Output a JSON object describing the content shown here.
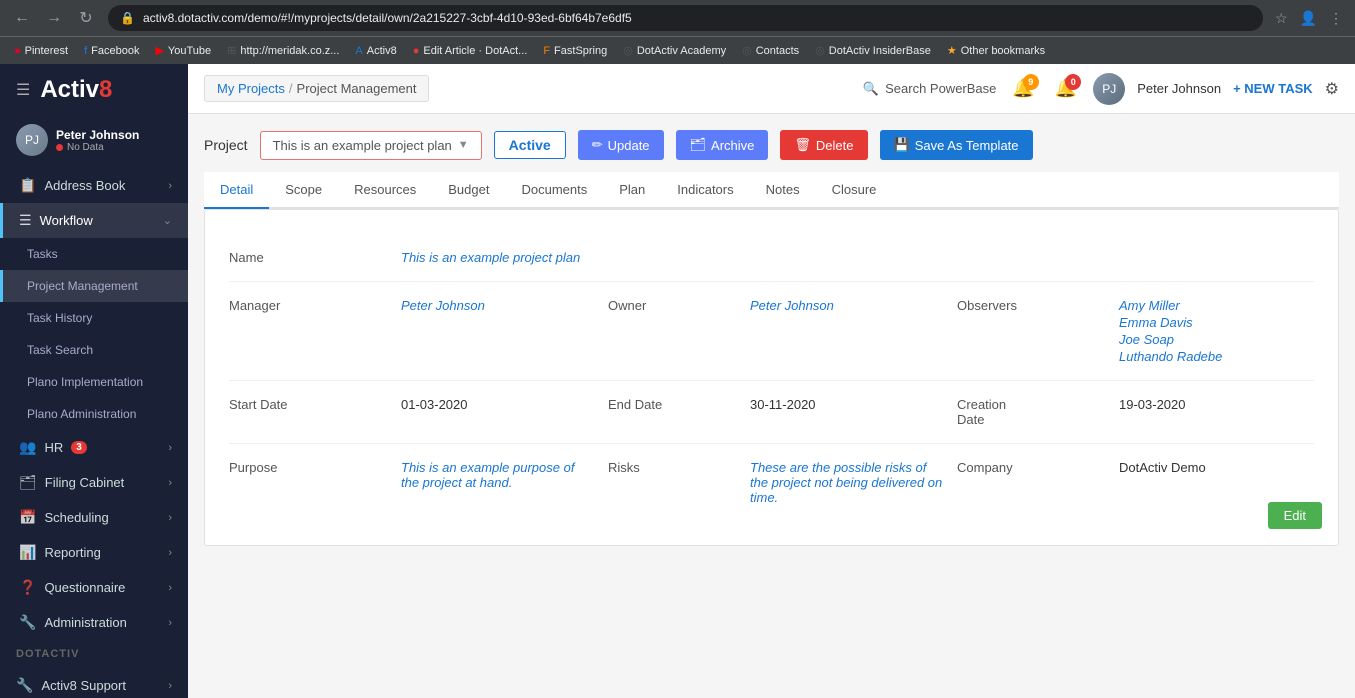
{
  "browser": {
    "url": "activ8.dotactiv.com/demo/#!/myprojects/detail/own/2a215227-3cbf-4d10-93ed-6bf64b7e6df5",
    "user": "Incognito"
  },
  "bookmarks": [
    {
      "label": "Pinterest",
      "color": "#e60023"
    },
    {
      "label": "Facebook",
      "color": "#1877f2"
    },
    {
      "label": "YouTube",
      "color": "#ff0000"
    },
    {
      "label": "http://meridak.co.z...",
      "color": "#555"
    },
    {
      "label": "Activ8",
      "color": "#1976d2"
    },
    {
      "label": "Edit Article · DotAct...",
      "color": "#555"
    },
    {
      "label": "FastSpring",
      "color": "#f57c00"
    },
    {
      "label": "DotActiv Academy",
      "color": "#555"
    },
    {
      "label": "Contacts",
      "color": "#555"
    },
    {
      "label": "DotActiv InsiderBase",
      "color": "#555"
    },
    {
      "label": "Other bookmarks",
      "color": "#f9a825"
    }
  ],
  "header": {
    "breadcrumb_link": "My Projects",
    "breadcrumb_sep": "/",
    "breadcrumb_current": "Project Management",
    "search_label": "Search PowerBase",
    "notif1_count": "9",
    "notif2_count": "0",
    "username": "Peter Johnson",
    "new_task_label": "+ NEW TASK"
  },
  "sidebar": {
    "logo": "Activ",
    "logo_accent": "8",
    "user": {
      "name": "Peter Johnson",
      "status": "No Data"
    },
    "nav_items": [
      {
        "label": "Address Book",
        "icon": "📋",
        "has_chevron": true,
        "indent": false
      },
      {
        "label": "Workflow",
        "icon": "☰",
        "has_chevron": true,
        "indent": false,
        "active": true
      },
      {
        "label": "Tasks",
        "indent": true
      },
      {
        "label": "Project Management",
        "indent": true,
        "active": true
      },
      {
        "label": "Task History",
        "indent": true
      },
      {
        "label": "Task Search",
        "indent": true
      },
      {
        "label": "Plano Implementation",
        "indent": true
      },
      {
        "label": "Plano Administration",
        "indent": true
      },
      {
        "label": "HR",
        "icon": "👥",
        "badge": "3",
        "has_chevron": true,
        "indent": false
      },
      {
        "label": "Filing Cabinet",
        "icon": "🗂",
        "has_chevron": true,
        "indent": false
      },
      {
        "label": "Scheduling",
        "icon": "📅",
        "has_chevron": true,
        "indent": false
      },
      {
        "label": "Reporting",
        "icon": "📊",
        "has_chevron": true,
        "indent": false
      },
      {
        "label": "Questionnaire",
        "icon": "❓",
        "has_chevron": true,
        "indent": false
      },
      {
        "label": "Administration",
        "icon": "🔧",
        "has_chevron": true,
        "indent": false
      }
    ],
    "dotactiv_label": "DOTACTIV",
    "activ8_support_label": "Activ8 Support"
  },
  "project": {
    "label": "Project",
    "dropdown_value": "This is an example project plan",
    "status": "Active",
    "btn_update": "Update",
    "btn_archive": "Archive",
    "btn_delete": "Delete",
    "btn_save_template": "Save As Template"
  },
  "tabs": [
    {
      "label": "Detail",
      "active": true
    },
    {
      "label": "Scope"
    },
    {
      "label": "Resources"
    },
    {
      "label": "Budget"
    },
    {
      "label": "Documents"
    },
    {
      "label": "Plan"
    },
    {
      "label": "Indicators"
    },
    {
      "label": "Notes"
    },
    {
      "label": "Closure"
    }
  ],
  "detail": {
    "name_label": "Name",
    "name_value": "This is an example project plan",
    "manager_label": "Manager",
    "manager_value": "Peter Johnson",
    "owner_label": "Owner",
    "owner_value": "Peter Johnson",
    "observers_label": "Observers",
    "observers": [
      "Amy Miller",
      "Emma Davis",
      "Joe Soap",
      "Luthando Radebe"
    ],
    "start_date_label": "Start Date",
    "start_date_value": "01-03-2020",
    "end_date_label": "End Date",
    "end_date_value": "30-11-2020",
    "creation_date_label": "Creation Date",
    "creation_date_value": "19-03-2020",
    "purpose_label": "Purpose",
    "purpose_value": "This is an example purpose of the project at hand.",
    "risks_label": "Risks",
    "risks_value": "These are the possible risks of the project not being delivered on time.",
    "company_label": "Company",
    "company_value": "DotActiv Demo",
    "edit_btn": "Edit"
  }
}
